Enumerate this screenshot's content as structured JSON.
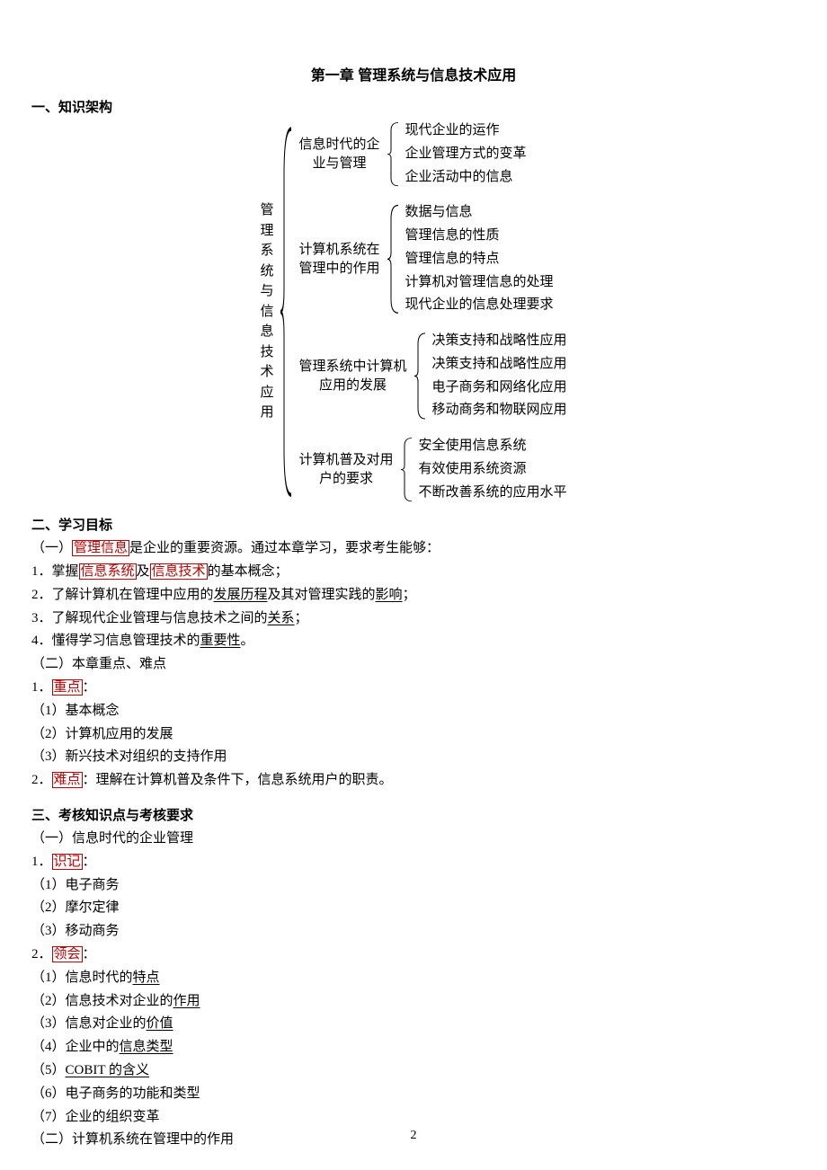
{
  "title": "第一章 管理系统与信息技术应用",
  "s1_head": "一、知识架构",
  "s2_head": "二、学习目标",
  "s3_head": "三、考核知识点与考核要求",
  "page_num": "2",
  "tree": {
    "root": "管理系统与信息技术应用",
    "b1": {
      "label1": "信息时代的企",
      "label2": "业与管理",
      "leaves": [
        "现代企业的运作",
        "企业管理方式的变革",
        "企业活动中的信息"
      ]
    },
    "b2": {
      "label1": "计算机系统在",
      "label2": "管理中的作用",
      "leaves": [
        "数据与信息",
        "管理信息的性质",
        "管理信息的特点",
        "计算机对管理信息的处理",
        "现代企业的信息处理要求"
      ]
    },
    "b3": {
      "label1": "管理系统中计算机",
      "label2": "应用的发展",
      "leaves": [
        "决策支持和战略性应用",
        "决策支持和战略性应用",
        "电子商务和网络化应用",
        "移动商务和物联网应用"
      ]
    },
    "b4": {
      "label1": "计算机普及对用",
      "label2": "户的要求",
      "leaves": [
        "安全使用信息系统",
        "有效使用系统资源",
        "不断改善系统的应用水平"
      ]
    }
  },
  "s2": {
    "l1a": "（一）",
    "l1b": "管理信息",
    "l1c": "是企业的重要资源。通过本章学习，要求考生能够：",
    "l2a": "1．掌握",
    "l2b": "信息系统",
    "l2c": "及",
    "l2d": "信息技术",
    "l2e": "的基本概念；",
    "l3a": "2．了解计算机在管理中应用的",
    "l3b": "发展历程",
    "l3c": "及其对管理实践的",
    "l3d": "影响",
    "l3e": "；",
    "l4a": "3．了解现代企业管理与信息技术之间的",
    "l4b": "关系",
    "l4c": "；",
    "l5a": "4．懂得学习信息管理技术的",
    "l5b": "重要性",
    "l5c": "。",
    "l6": "（二）本章重点、难点",
    "l7a": "1．",
    "l7b": "重点",
    "l7c": "：",
    "l8": "（1）基本概念",
    "l9": "（2）计算机应用的发展",
    "l10": "（3）新兴技术对组织的支持作用",
    "l11a": "2．",
    "l11b": "难点",
    "l11c": "：理解在计算机普及条件下，信息系统用户的职责。"
  },
  "s3": {
    "l1": "（一）信息时代的企业管理",
    "l2a": "1．",
    "l2b": "识记",
    "l2c": "：",
    "l3": "（1）电子商务",
    "l4": "（2）摩尔定律",
    "l5": "（3）移动商务",
    "l6a": "2．",
    "l6b": "领会",
    "l6c": "：",
    "l7a": "（1）信息时代的",
    "l7b": "特点",
    "l8a": "（2）信息技术对企业的",
    "l8b": "作用",
    "l9a": "（3）信息对企业的",
    "l9b": "价值",
    "l10a": "（4）企业中的",
    "l10b": "信息类型",
    "l11a": "（5）",
    "l11b": "COBIT 的含义",
    "l12": "（6）电子商务的功能和类型",
    "l13": "（7）企业的组织变革",
    "l14": "（二）计算机系统在管理中的作用"
  }
}
